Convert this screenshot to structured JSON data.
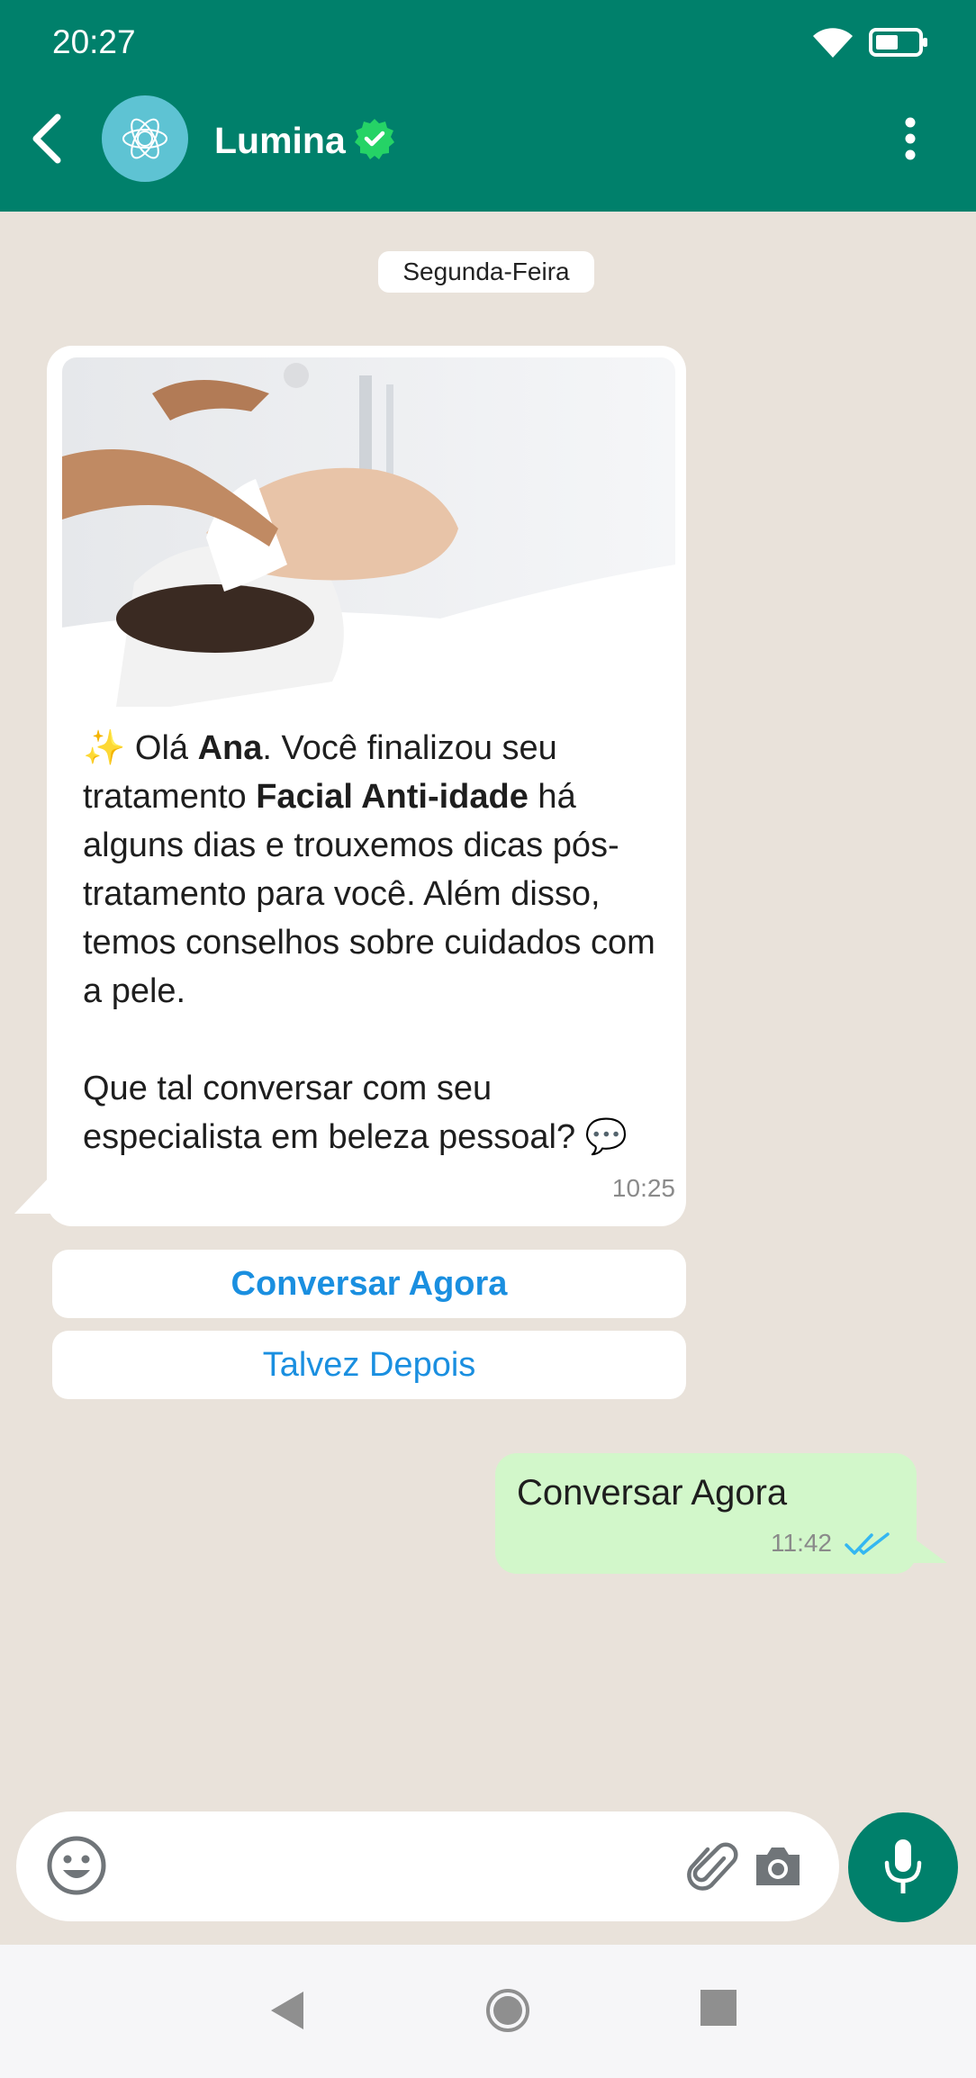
{
  "status_bar": {
    "time": "20:27"
  },
  "header": {
    "contact_name": "Lumina"
  },
  "chat": {
    "date_label": "Segunda-Feira",
    "incoming": {
      "greeting_emoji": "✨",
      "p1_a": " Olá ",
      "p1_name": "Ana",
      "p1_b": ". Você finalizou seu tratamento ",
      "p1_treatment": "Facial Anti-idade",
      "p1_c": " há alguns dias e trouxemos dicas pós-tratamento para você. Além disso, temos conselhos sobre cuidados com a pele.",
      "p2": "Que tal conversar com seu especialista em beleza pessoal? ",
      "p2_emoji": "💬",
      "time": "10:25"
    },
    "quick_replies": {
      "primary": "Conversar Agora",
      "secondary": "Talvez Depois"
    },
    "outgoing": {
      "text": "Conversar Agora",
      "time": "11:42"
    }
  },
  "composer": {
    "placeholder": ""
  },
  "colors": {
    "header": "#00806b",
    "chat_background": "#e9e2da",
    "outgoing_bubble": "#d2f7ca",
    "link_blue": "#1a8fe0",
    "verified_green": "#25d366",
    "read_check": "#34b7f1"
  }
}
